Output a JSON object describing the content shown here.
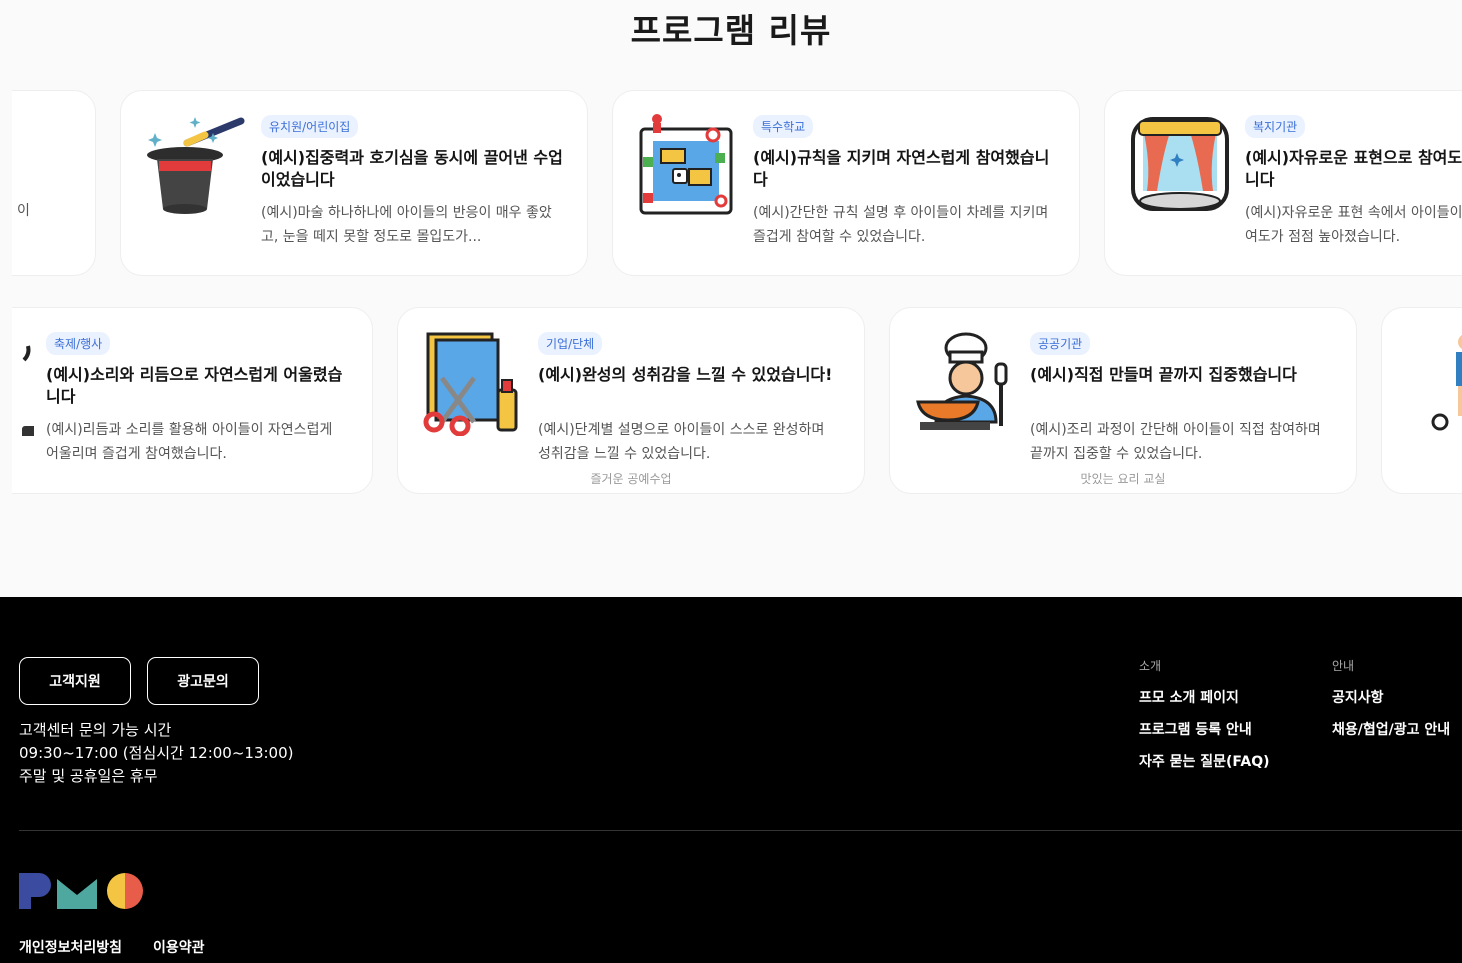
{
  "section": {
    "title": "프로그램 리뷰"
  },
  "row1": [
    {
      "tag": "",
      "title": "",
      "desc": "이",
      "caption": ""
    },
    {
      "tag": "유치원/어린이집",
      "title": "(예시)집중력과 호기심을 동시에 끌어낸 수업이었습니다",
      "desc": "(예시)마술 하나하나에 아이들의 반응이 매우 좋았고, 눈을 떼지 못할 정도로 몰입도가...",
      "caption": "",
      "icon": "magic-hat-icon"
    },
    {
      "tag": "특수학교",
      "title": "(예시)규칙을 지키며 자연스럽게 참여했습니다",
      "desc": "(예시)간단한 규칙 설명 후 아이들이 차례를 지키며 즐겁게 참여할 수 있었습니다.",
      "caption": "",
      "icon": "board-game-icon"
    },
    {
      "tag": "복지기관",
      "title": "(예시)자유로운 표현으로 참여도가 높아졌습니다",
      "desc": "(예시)자유로운 표현 속에서 아이들이 드러나며 참여도가 점점 높아졌습니다.",
      "caption": "",
      "icon": "theater-stage-icon"
    }
  ],
  "row2": [
    {
      "tag": "축제/행사",
      "title": "(예시)소리와 리듬으로 자연스럽게 어울렸습니다",
      "desc": "(예시)리듬과 소리를 활용해 아이들이 자연스럽게 어울리며 즐겁게 참여했습니다.",
      "caption": "",
      "icon": "music-icon"
    },
    {
      "tag": "기업/단체",
      "title": "(예시)완성의 성취감을 느낄 수 있었습니다!",
      "desc": "(예시)단계별 설명으로 아이들이 스스로 완성하며 성취감을 느낄 수 있었습니다.",
      "caption": "즐거운 공예수업",
      "icon": "craft-scissors-icon"
    },
    {
      "tag": "공공기관",
      "title": "(예시)직접 만들며 끝까지 집중했습니다",
      "desc": "(예시)조리 과정이 간단해 아이들이 직접 참여하며 끝까지 집중할 수 있었습니다.",
      "caption": "맛있는 요리 교실",
      "icon": "chef-cooking-icon"
    },
    {
      "tag": "",
      "title": "",
      "desc": "",
      "caption": "",
      "icon": "soccer-player-icon"
    }
  ],
  "footer": {
    "support_button": "고객지원",
    "ad_button": "광고문의",
    "hours_label": "고객센터 문의 가능 시간",
    "hours_time": "09:30~17:00 (점심시간 12:00~13:00)",
    "hours_closed": "주말 및 공휴일은 휴무",
    "col1_head": "소개",
    "col1_links": [
      "프모 소개 페이지",
      "프로그램 등록 안내",
      "자주 묻는 질문(FAQ)"
    ],
    "col2_head": "안내",
    "col2_links": [
      "공지사항",
      "채용/협업/광고 안내"
    ],
    "privacy": "개인정보처리방침",
    "terms": "이용약관",
    "logo_colors": [
      "#3a4ba0",
      "#4fa8a0",
      "#f4c542",
      "#e85d4a"
    ]
  }
}
